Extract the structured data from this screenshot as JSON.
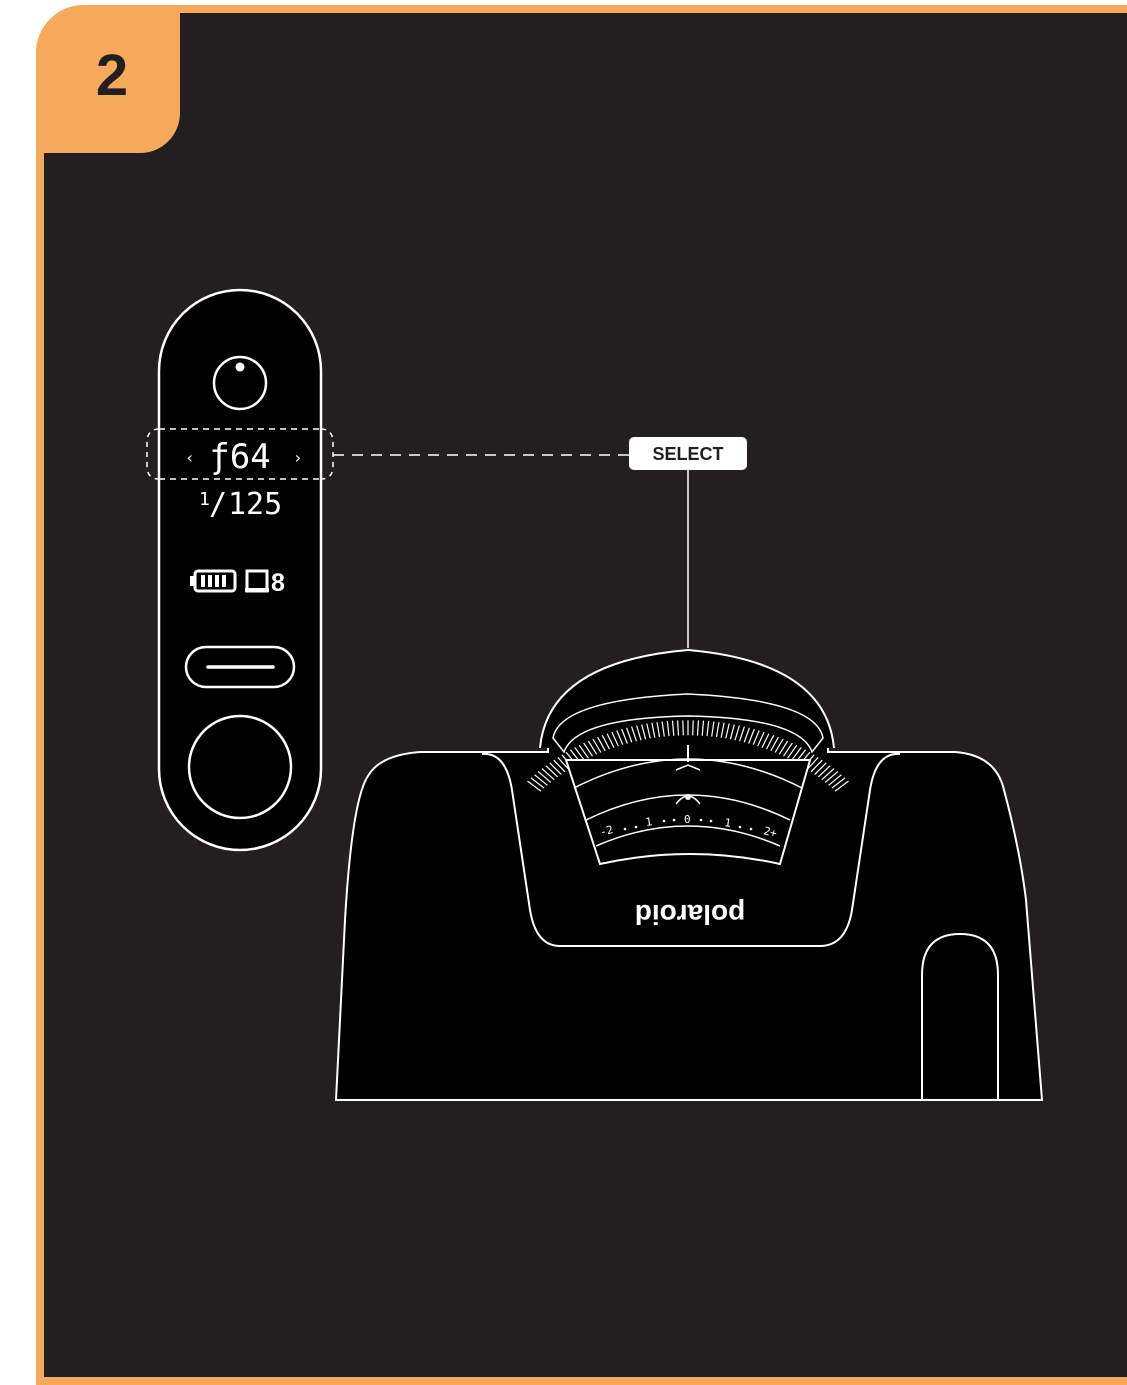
{
  "step": {
    "number": "2"
  },
  "colors": {
    "accent": "#f6a95b",
    "background": "#231f20",
    "line": "#ffffff",
    "device": "#000000"
  },
  "remote_display": {
    "aperture": "ƒ64",
    "shutter_numerator": "1",
    "shutter_denominator": "125",
    "frames_remaining": "8",
    "icons": [
      "sensor-icon",
      "chevron-left-icon",
      "chevron-right-icon",
      "battery-icon",
      "film-frame-icon",
      "button-bar-icon",
      "shutter-button-icon"
    ]
  },
  "callout": {
    "label": "SELECT"
  },
  "camera": {
    "brand": "polaroid",
    "ev_scale": [
      "-2",
      "1",
      "0",
      "1",
      "2+"
    ]
  }
}
